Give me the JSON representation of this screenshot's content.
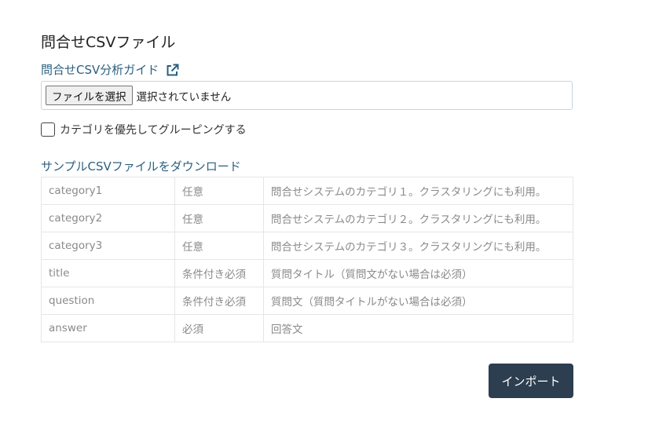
{
  "section": {
    "title": "問合せCSVファイル"
  },
  "guide_link": {
    "label": "問合せCSV分析ガイド",
    "icon": "external-link-icon"
  },
  "file_input": {
    "button_label": "ファイルを選択",
    "status": "選択されていません"
  },
  "grouping_option": {
    "label": "カテゴリを優先してグルーピングする",
    "checked": false
  },
  "sample_link": {
    "label": "サンプルCSVファイルをダウンロード"
  },
  "fields": [
    {
      "name": "category1",
      "requirement": "任意",
      "description": "問合せシステムのカテゴリ１。クラスタリングにも利用。"
    },
    {
      "name": "category2",
      "requirement": "任意",
      "description": "問合せシステムのカテゴリ２。クラスタリングにも利用。"
    },
    {
      "name": "category3",
      "requirement": "任意",
      "description": "問合せシステムのカテゴリ３。クラスタリングにも利用。"
    },
    {
      "name": "title",
      "requirement": "条件付き必須",
      "description": "質問タイトル（質問文がない場合は必須）"
    },
    {
      "name": "question",
      "requirement": "条件付き必須",
      "description": "質問文（質問タイトルがない場合は必須）"
    },
    {
      "name": "answer",
      "requirement": "必須",
      "description": "回答文"
    }
  ],
  "import_button": {
    "label": "インポート"
  },
  "colors": {
    "link": "#2b5f80",
    "primary_button": "#2c3e50",
    "table_text": "#8a8a8a"
  }
}
